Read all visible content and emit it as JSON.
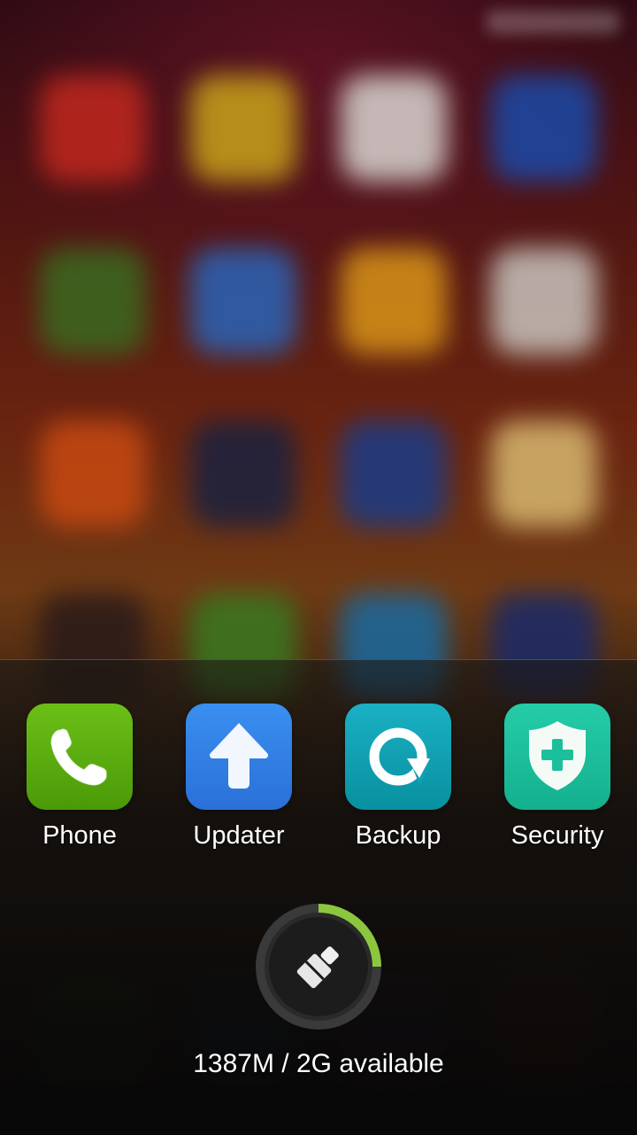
{
  "recent_apps": [
    {
      "label": "Phone",
      "icon": "phone-icon",
      "color": "#5aad10"
    },
    {
      "label": "Updater",
      "icon": "up-arrow-icon",
      "color": "#2f7fe6"
    },
    {
      "label": "Backup",
      "icon": "backup-icon",
      "color": "#10a0b2"
    },
    {
      "label": "Security",
      "icon": "shield-icon",
      "color": "#1cbf9c"
    }
  ],
  "memory": {
    "text": "1387M / 2G available",
    "available_mb": 1387,
    "total": "2G",
    "ring_fill_fraction": 0.25,
    "ring_color": "#8cc63f",
    "icon": "broom-icon"
  }
}
